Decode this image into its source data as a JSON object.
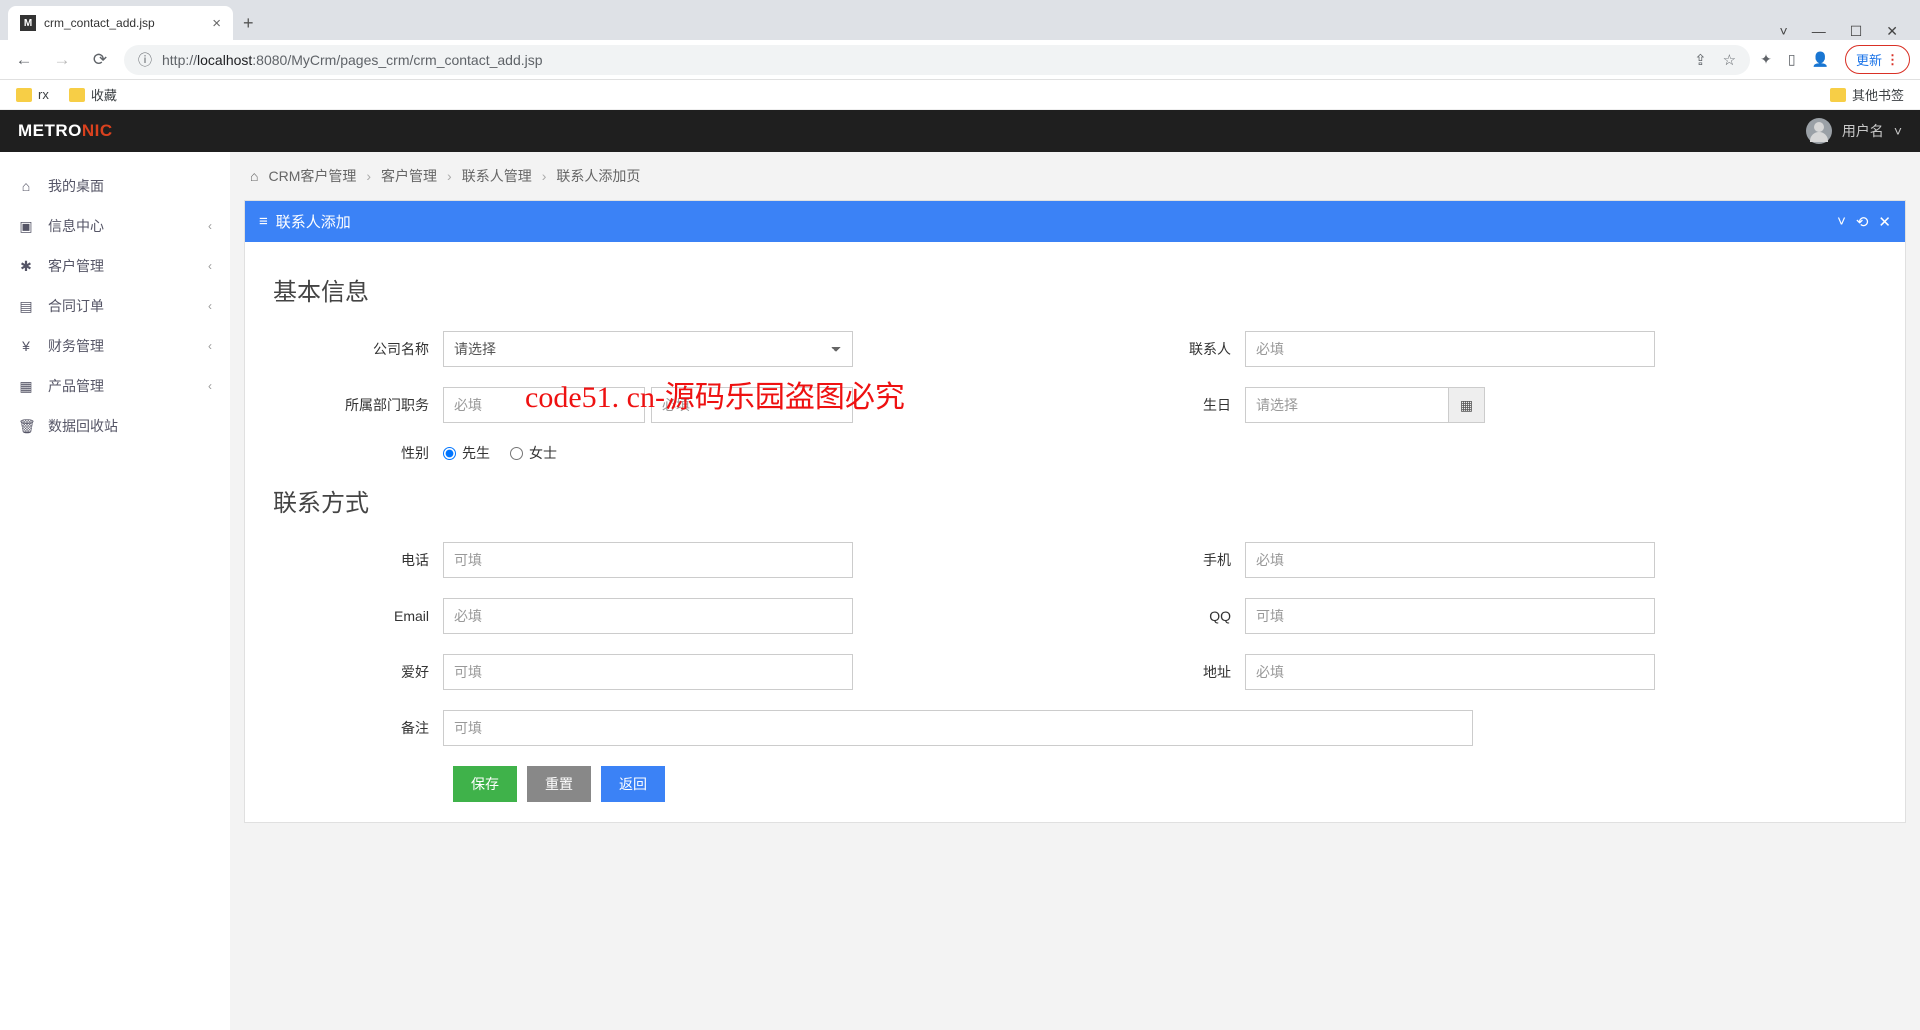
{
  "browser": {
    "tab_title": "crm_contact_add.jsp",
    "url_host": "localhost",
    "url_port": ":8080",
    "url_path": "/MyCrm/pages_crm/crm_contact_add.jsp",
    "url_prefix": "http://",
    "update_label": "更新",
    "bookmarks": {
      "rx": "rx",
      "fav": "收藏",
      "other": "其他书签"
    }
  },
  "header": {
    "logo_a": "METRO",
    "logo_b": "NIC",
    "username": "用户名"
  },
  "sidebar": {
    "items": [
      {
        "icon": "⌂",
        "label": "我的桌面",
        "expandable": false
      },
      {
        "icon": "▣",
        "label": "信息中心",
        "expandable": true
      },
      {
        "icon": "✱",
        "label": "客户管理",
        "expandable": true
      },
      {
        "icon": "▤",
        "label": "合同订单",
        "expandable": true
      },
      {
        "icon": "¥",
        "label": "财务管理",
        "expandable": true
      },
      {
        "icon": "▦",
        "label": "产品管理",
        "expandable": true
      },
      {
        "icon": "🗑",
        "label": "数据回收站",
        "expandable": false
      }
    ]
  },
  "breadcrumb": {
    "items": [
      "CRM客户管理",
      "客户管理",
      "联系人管理",
      "联系人添加页"
    ]
  },
  "panel": {
    "title": "联系人添加"
  },
  "form": {
    "section_basic": "基本信息",
    "section_contact": "联系方式",
    "labels": {
      "company": "公司名称",
      "contact": "联系人",
      "dept_job": "所属部门职务",
      "birthday": "生日",
      "gender": "性别",
      "phone": "电话",
      "mobile": "手机",
      "email": "Email",
      "qq": "QQ",
      "hobby": "爱好",
      "address": "地址",
      "remark": "备注"
    },
    "placeholders": {
      "select": "请选择",
      "required": "必填",
      "optional": "可填"
    },
    "gender_options": {
      "male": "先生",
      "female": "女士"
    },
    "buttons": {
      "save": "保存",
      "reset": "重置",
      "back": "返回"
    }
  },
  "watermark": "code51. cn-源码乐园盗图必究"
}
